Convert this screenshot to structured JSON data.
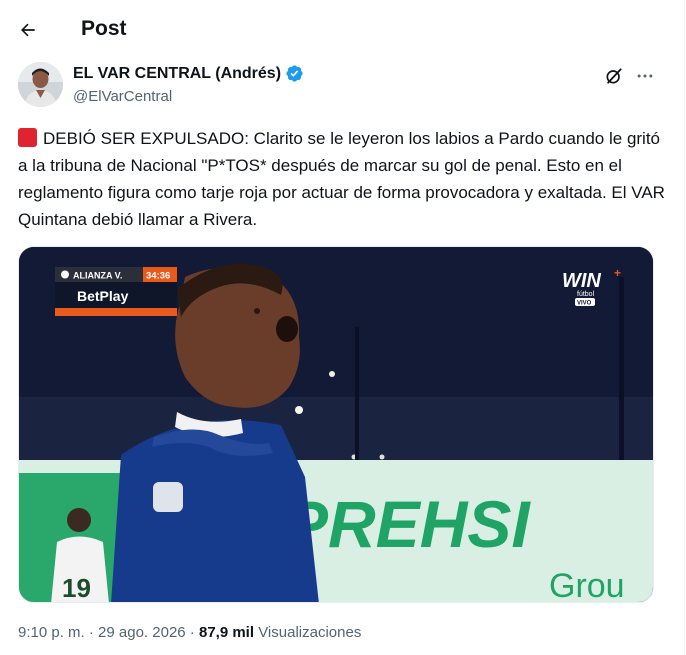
{
  "header": {
    "title": "Post",
    "back_icon": "arrow-left-icon"
  },
  "author": {
    "name": "EL VAR CENTRAL (Andrés)",
    "handle": "@ElVarCentral",
    "verified_color": "#1d9bf0"
  },
  "post": {
    "emoji": "red-square",
    "text": "DEBIÓ SER EXPULSADO: Clarito se le leyeron los labios a Pardo cuando le gritó a la tribuna de Nacional \"P*TOS* después de marcar su gol de penal. Esto en el reglamento figura como tarje roja por actuar de forma provocadora y exaltada. El VAR Quintana debió llamar a Rivera."
  },
  "media": {
    "scoreboard": {
      "team": "ALIANZA V.",
      "clock": "34:36",
      "sponsor": "BetPlay"
    },
    "broadcaster": {
      "logo": "WIN",
      "sub": "fútbol",
      "live": "VIVO"
    },
    "ad_board_text": "PREHSI",
    "ad_board_text_2": "Grou",
    "background_player_number": "19"
  },
  "meta": {
    "time": "9:10 p. m.",
    "separator": " · ",
    "date": "29 ago. 2026",
    "separator2": " · ",
    "views_count": "87,9 mil",
    "views_label": "Visualizaciones"
  },
  "colors": {
    "text_primary": "#0f1419",
    "text_secondary": "#536471",
    "accent": "#1d9bf0"
  }
}
